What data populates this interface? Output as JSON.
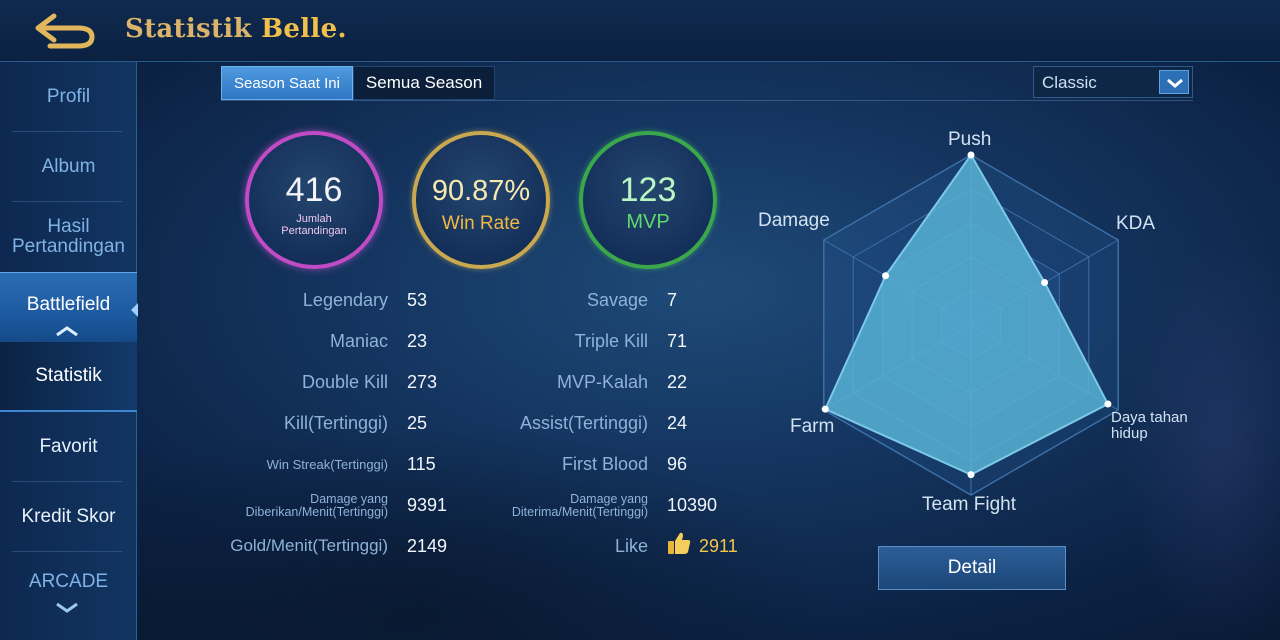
{
  "header": {
    "title_prefix": "Statistik ",
    "hero_name": "Belle",
    "title_suffix": "."
  },
  "sidebar": {
    "items": [
      {
        "label": "Profil"
      },
      {
        "label": "Album"
      },
      {
        "label": "Hasil Pertandingan"
      },
      {
        "label": "Battlefield"
      },
      {
        "label": "Statistik"
      },
      {
        "label": "Favorit"
      },
      {
        "label": "Kredit Skor"
      },
      {
        "label": "ARCADE"
      }
    ]
  },
  "tabs": [
    {
      "label": "Season Saat Ini"
    },
    {
      "label": "Semua Season"
    }
  ],
  "mode_dropdown": {
    "value": "Classic"
  },
  "summary": {
    "matches": {
      "value": "416",
      "label": "Jumlah Pertandingan"
    },
    "win_rate": {
      "value": "90.87%",
      "label": "Win Rate"
    },
    "mvp": {
      "value": "123",
      "label": "MVP"
    }
  },
  "stats_left": [
    {
      "label": "Legendary",
      "value": "53"
    },
    {
      "label": "Maniac",
      "value": "23"
    },
    {
      "label": "Double Kill",
      "value": "273"
    },
    {
      "label": "Kill(Tertinggi)",
      "value": "25"
    },
    {
      "label": "Win Streak(Tertinggi)",
      "value": "115"
    },
    {
      "label": "Damage yang Diberikan/Menit(Tertinggi)",
      "value": "9391"
    },
    {
      "label": "Gold/Menit(Tertinggi)",
      "value": "2149"
    }
  ],
  "stats_right": [
    {
      "label": "Savage",
      "value": "7"
    },
    {
      "label": "Triple Kill",
      "value": "71"
    },
    {
      "label": "MVP-Kalah",
      "value": "22"
    },
    {
      "label": "Assist(Tertinggi)",
      "value": "24"
    },
    {
      "label": "First Blood",
      "value": "96"
    },
    {
      "label": "Damage yang Diterima/Menit(Tertinggi)",
      "value": "10390"
    },
    {
      "label": "Like",
      "value": "2911"
    }
  ],
  "radar": {
    "axes": [
      {
        "label": "Push",
        "level": 1.0
      },
      {
        "label": "KDA",
        "level": 0.5
      },
      {
        "label": "Daya tahan hidup",
        "level": 0.93
      },
      {
        "label": "Team Fight",
        "level": 0.88
      },
      {
        "label": "Farm",
        "level": 0.99
      },
      {
        "label": "Damage",
        "level": 0.58
      }
    ],
    "colors": {
      "fill": "#5ab6d8",
      "outline": "#7cc8e8",
      "grid": "#3b6fa6"
    }
  },
  "detail_button": {
    "label": "Detail"
  },
  "colors": {
    "title_gold": "#d9b46a",
    "hero_gold": "#f1c04a",
    "matches_ring": "#c04bc4",
    "winrate_ring": "#c9a850",
    "mvp_ring": "#3aa84a",
    "accent_blue": "#2f76c2"
  }
}
